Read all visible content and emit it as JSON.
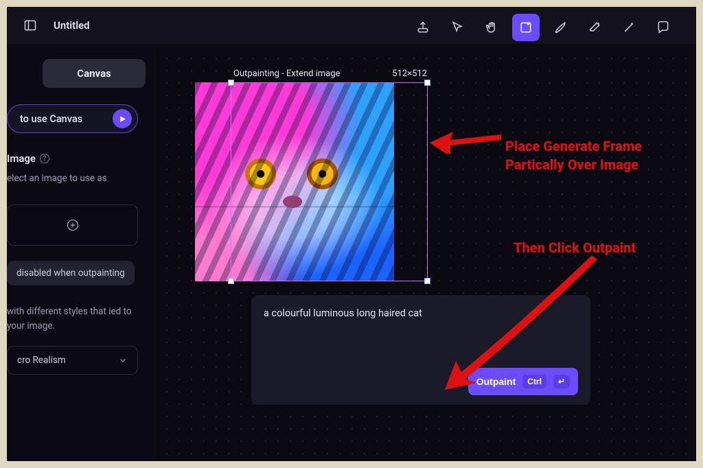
{
  "title": "Untitled",
  "sidebar": {
    "tab": "Canvas",
    "how_to": "to use Canvas",
    "section_image": "Image",
    "section_sub": "elect an image to use as",
    "chip": "disabled when outpainting",
    "styles_text": "with different styles that ied to your image.",
    "select_value": "cro Realism"
  },
  "canvas": {
    "frame_title": "Outpainting - Extend image",
    "frame_dim": "512×512"
  },
  "prompt": {
    "text": "a colourful luminous long haired cat",
    "button": "Outpaint",
    "kbd1": "Ctrl",
    "kbd2": "↵"
  },
  "annotations": {
    "a1_l1": "Place Generate Frame",
    "a1_l2": "Partically Over Image",
    "a2": "Then Click Outpaint"
  }
}
